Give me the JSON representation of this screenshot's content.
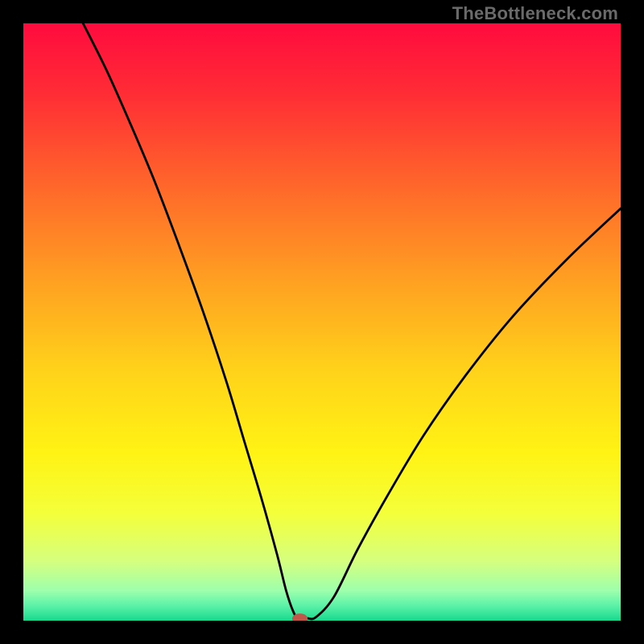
{
  "watermark": "TheBottleneck.com",
  "chart_data": {
    "type": "line",
    "title": "",
    "xlabel": "",
    "ylabel": "",
    "xlim": [
      0,
      100
    ],
    "ylim": [
      0,
      100
    ],
    "grid": false,
    "legend": false,
    "background_gradient": {
      "stops": [
        {
          "offset": 0.0,
          "color": "#ff0b3e"
        },
        {
          "offset": 0.12,
          "color": "#ff2d35"
        },
        {
          "offset": 0.28,
          "color": "#ff6a2a"
        },
        {
          "offset": 0.44,
          "color": "#ffa321"
        },
        {
          "offset": 0.58,
          "color": "#ffd21a"
        },
        {
          "offset": 0.72,
          "color": "#fff314"
        },
        {
          "offset": 0.82,
          "color": "#f4ff3a"
        },
        {
          "offset": 0.9,
          "color": "#d6ff7e"
        },
        {
          "offset": 0.95,
          "color": "#9dffac"
        },
        {
          "offset": 0.975,
          "color": "#5bf2a8"
        },
        {
          "offset": 1.0,
          "color": "#17d98e"
        }
      ]
    },
    "series": [
      {
        "name": "bottleneck-curve",
        "x": [
          10.0,
          14.0,
          18.0,
          22.0,
          26.0,
          30.0,
          34.0,
          37.0,
          40.0,
          42.5,
          44.0,
          45.2,
          46.0,
          47.5,
          49.0,
          52.0,
          56.0,
          61.0,
          67.0,
          74.0,
          82.0,
          91.0,
          100.0
        ],
        "y": [
          100.0,
          92.0,
          83.0,
          73.5,
          63.0,
          52.0,
          40.0,
          30.0,
          20.0,
          11.0,
          5.0,
          1.5,
          0.5,
          0.4,
          0.6,
          4.0,
          12.0,
          21.0,
          31.0,
          41.0,
          51.0,
          60.5,
          69.0
        ]
      }
    ],
    "marker": {
      "name": "optimal-point",
      "x": 46.3,
      "y": 0.35,
      "rx": 1.3,
      "ry": 0.85,
      "color": "#c0574a"
    }
  }
}
